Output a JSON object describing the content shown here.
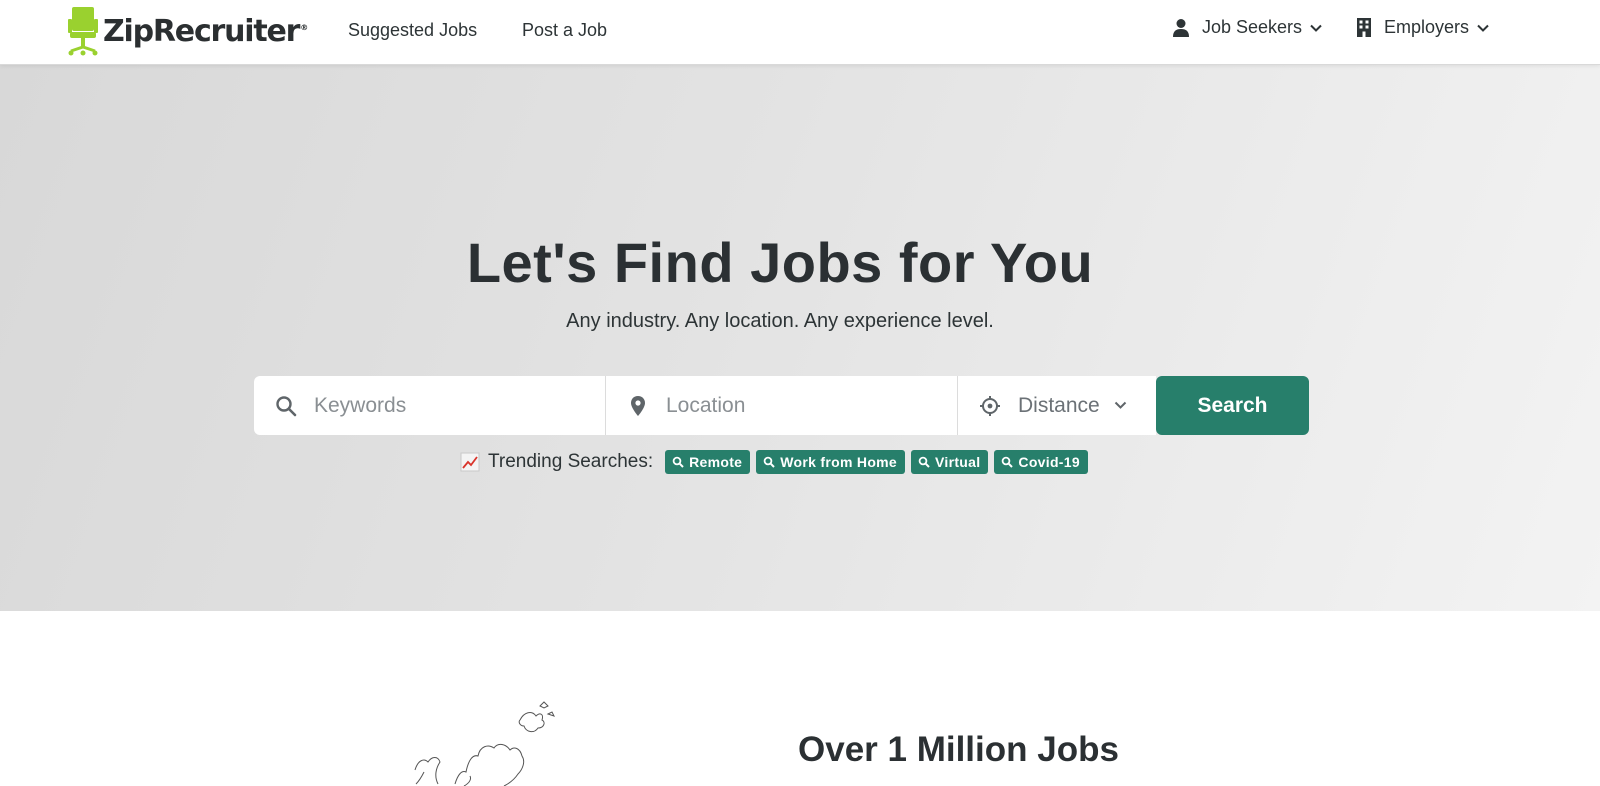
{
  "brand": {
    "name": "ZipRecruiter",
    "registered": "®",
    "logo_color": "#9ad12f"
  },
  "nav": {
    "suggested_jobs": "Suggested Jobs",
    "post_a_job": "Post a Job",
    "job_seekers": "Job Seekers",
    "employers": "Employers"
  },
  "hero": {
    "title": "Let's Find Jobs for You",
    "subtitle": "Any industry. Any location. Any experience level.",
    "keywords_placeholder": "Keywords",
    "location_placeholder": "Location",
    "distance_label": "Distance",
    "search_button": "Search",
    "trending_label": "Trending Searches:",
    "trending_tags": [
      "Remote",
      "Work from Home",
      "Virtual",
      "Covid-19"
    ]
  },
  "section": {
    "title": "Over 1 Million Jobs"
  },
  "colors": {
    "accent": "#277f6b",
    "text": "#2d3436"
  },
  "icons": [
    "person-icon",
    "building-icon",
    "chevron-down-icon",
    "search-icon",
    "map-pin-icon",
    "crosshair-icon",
    "trending-chart-icon",
    "world-map-outline"
  ]
}
